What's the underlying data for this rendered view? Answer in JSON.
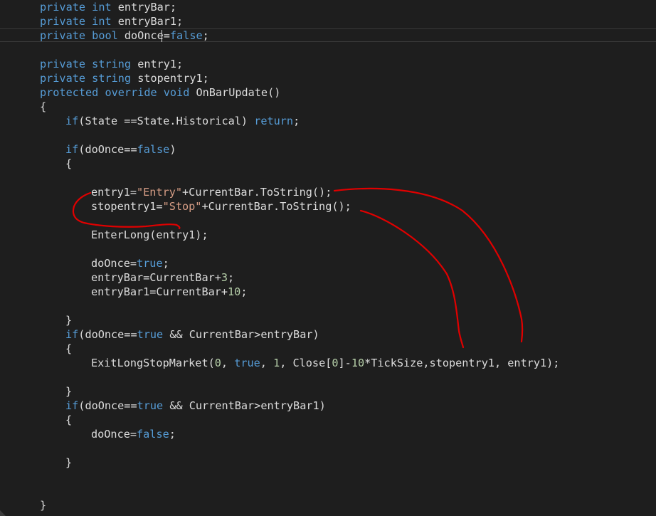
{
  "editor": {
    "theme": {
      "background": "#1e1e1e",
      "keyword": "#569cd6",
      "string": "#d69d85",
      "number": "#b5cea8",
      "text": "#dcdcdc",
      "annotation": "#e00000"
    },
    "lines": [
      {
        "indent": 4,
        "tokens": [
          [
            "k",
            "private"
          ],
          [
            "p",
            " "
          ],
          [
            "k",
            "int"
          ],
          [
            "p",
            " entryBar;"
          ]
        ]
      },
      {
        "indent": 4,
        "tokens": [
          [
            "k",
            "private"
          ],
          [
            "p",
            " "
          ],
          [
            "k",
            "int"
          ],
          [
            "p",
            " entryBar1;"
          ]
        ]
      },
      {
        "indent": 4,
        "tokens": [
          [
            "k",
            "private"
          ],
          [
            "p",
            " "
          ],
          [
            "k",
            "bool"
          ],
          [
            "p",
            " doOnce="
          ],
          [
            "k",
            "false"
          ],
          [
            "p",
            ";"
          ]
        ]
      },
      {
        "indent": 0,
        "tokens": []
      },
      {
        "indent": 4,
        "tokens": [
          [
            "k",
            "private"
          ],
          [
            "p",
            " "
          ],
          [
            "k",
            "string"
          ],
          [
            "p",
            " entry1;"
          ]
        ]
      },
      {
        "indent": 4,
        "tokens": [
          [
            "k",
            "private"
          ],
          [
            "p",
            " "
          ],
          [
            "k",
            "string"
          ],
          [
            "p",
            " stopentry1;"
          ]
        ]
      },
      {
        "indent": 4,
        "tokens": [
          [
            "k",
            "protected"
          ],
          [
            "p",
            " "
          ],
          [
            "k",
            "override"
          ],
          [
            "p",
            " "
          ],
          [
            "k",
            "void"
          ],
          [
            "p",
            " OnBarUpdate()"
          ]
        ]
      },
      {
        "indent": 4,
        "tokens": [
          [
            "p",
            "{"
          ]
        ]
      },
      {
        "indent": 8,
        "tokens": [
          [
            "k",
            "if"
          ],
          [
            "p",
            "(State ==State.Historical) "
          ],
          [
            "k",
            "return"
          ],
          [
            "p",
            ";"
          ]
        ]
      },
      {
        "indent": 0,
        "tokens": []
      },
      {
        "indent": 8,
        "tokens": [
          [
            "k",
            "if"
          ],
          [
            "p",
            "(doOnce=="
          ],
          [
            "k",
            "false"
          ],
          [
            "p",
            ")"
          ]
        ]
      },
      {
        "indent": 8,
        "tokens": [
          [
            "p",
            "{"
          ]
        ]
      },
      {
        "indent": 0,
        "tokens": []
      },
      {
        "indent": 12,
        "tokens": [
          [
            "p",
            "entry1="
          ],
          [
            "s",
            "\"Entry\""
          ],
          [
            "p",
            "+CurrentBar.ToString();"
          ]
        ]
      },
      {
        "indent": 12,
        "tokens": [
          [
            "p",
            "stopentry1="
          ],
          [
            "s",
            "\"Stop\""
          ],
          [
            "p",
            "+CurrentBar.ToString();"
          ]
        ]
      },
      {
        "indent": 0,
        "tokens": []
      },
      {
        "indent": 12,
        "tokens": [
          [
            "p",
            "EnterLong(entry1);"
          ]
        ]
      },
      {
        "indent": 0,
        "tokens": []
      },
      {
        "indent": 12,
        "tokens": [
          [
            "p",
            "doOnce="
          ],
          [
            "k",
            "true"
          ],
          [
            "p",
            ";"
          ]
        ]
      },
      {
        "indent": 12,
        "tokens": [
          [
            "p",
            "entryBar=CurrentBar+"
          ],
          [
            "n",
            "3"
          ],
          [
            "p",
            ";"
          ]
        ]
      },
      {
        "indent": 12,
        "tokens": [
          [
            "p",
            "entryBar1=CurrentBar+"
          ],
          [
            "n",
            "10"
          ],
          [
            "p",
            ";"
          ]
        ]
      },
      {
        "indent": 0,
        "tokens": []
      },
      {
        "indent": 8,
        "tokens": [
          [
            "p",
            "}"
          ]
        ]
      },
      {
        "indent": 8,
        "tokens": [
          [
            "k",
            "if"
          ],
          [
            "p",
            "(doOnce=="
          ],
          [
            "k",
            "true"
          ],
          [
            "p",
            " && CurrentBar>entryBar)"
          ]
        ]
      },
      {
        "indent": 8,
        "tokens": [
          [
            "p",
            "{"
          ]
        ]
      },
      {
        "indent": 12,
        "tokens": [
          [
            "p",
            "ExitLongStopMarket("
          ],
          [
            "n",
            "0"
          ],
          [
            "p",
            ", "
          ],
          [
            "k",
            "true"
          ],
          [
            "p",
            ", "
          ],
          [
            "n",
            "1"
          ],
          [
            "p",
            ", Close["
          ],
          [
            "n",
            "0"
          ],
          [
            "p",
            "]-"
          ],
          [
            "n",
            "10"
          ],
          [
            "p",
            "*TickSize,stopentry1, entry1);"
          ]
        ]
      },
      {
        "indent": 0,
        "tokens": []
      },
      {
        "indent": 8,
        "tokens": [
          [
            "p",
            "}"
          ]
        ]
      },
      {
        "indent": 8,
        "tokens": [
          [
            "k",
            "if"
          ],
          [
            "p",
            "(doOnce=="
          ],
          [
            "k",
            "true"
          ],
          [
            "p",
            " && CurrentBar>entryBar1)"
          ]
        ]
      },
      {
        "indent": 8,
        "tokens": [
          [
            "p",
            "{"
          ]
        ]
      },
      {
        "indent": 12,
        "tokens": [
          [
            "p",
            "doOnce="
          ],
          [
            "k",
            "false"
          ],
          [
            "p",
            ";"
          ]
        ]
      },
      {
        "indent": 0,
        "tokens": []
      },
      {
        "indent": 8,
        "tokens": [
          [
            "p",
            "}"
          ]
        ]
      },
      {
        "indent": 0,
        "tokens": []
      },
      {
        "indent": 0,
        "tokens": []
      },
      {
        "indent": 4,
        "tokens": [
          [
            "p",
            "}"
          ]
        ]
      }
    ],
    "cursor": {
      "line": 3,
      "column": 19
    }
  }
}
